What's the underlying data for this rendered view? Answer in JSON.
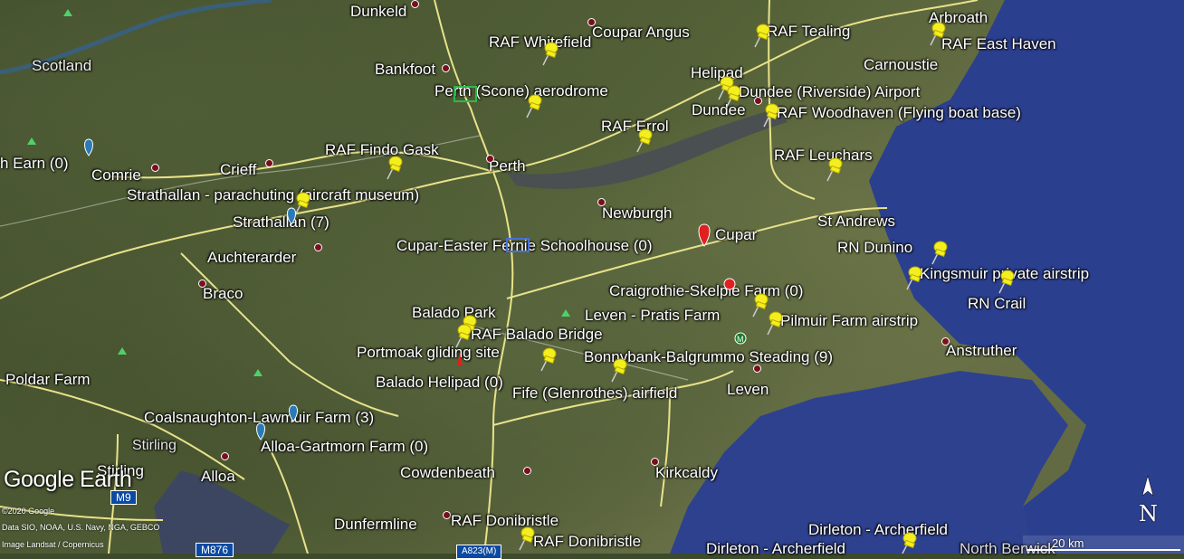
{
  "map": {
    "water_color": "#2b3f8f",
    "road_color": "#e8e28a",
    "pin_color": "#f3ef1f",
    "dot_color": "#7a0f1c"
  },
  "places": {
    "dunkeld": "Dunkeld",
    "coupar_angus": "Coupar Angus",
    "raf_tealing": "RAF Tealing",
    "arbroath": "Arbroath",
    "raf_east_haven": "RAF East Haven",
    "scotland": "Scotland",
    "raf_whitefield": "RAF Whitefield",
    "bankfoot": "Bankfoot",
    "carnoustie": "Carnoustie",
    "helipad": "Helipad",
    "perth_scone": "Perth (Scone) aerodrome",
    "dundee_riverside": "Dundee (Riverside) Airport",
    "dundee": "Dundee",
    "raf_woodhaven": "RAF Woodhaven (Flying boat base)",
    "raf_errol": "RAF Errol",
    "earn": "h Earn (0)",
    "raf_findo_gask": "RAF Findo Gask",
    "perth": "Perth",
    "raf_leuchars": "RAF Leuchars",
    "comrie": "Comrie",
    "crieff": "Crieff",
    "strathallan_para": "Strathallan - parachuting (aircraft museum)",
    "newburgh": "Newburgh",
    "strathallan": "Strathallan (7)",
    "st_andrews": "St Andrews",
    "cupar_easter": "Cupar-Easter Fernie Schoolhouse (0)",
    "cupar": "Cupar",
    "rn_dunino": "RN Dunino",
    "auchterarder": "Auchterarder",
    "kingsmuir": "Kingsmuir private airstrip",
    "rn_crail": "RN Crail",
    "braco": "Braco",
    "craigrothie": "Craigrothie-Skelpie Farm (0)",
    "balado_park": "Balado Park",
    "leven_pratis": "Leven - Pratis Farm",
    "pilmuir": "Pilmuir Farm airstrip",
    "raf_balado_bridge": "RAF Balado Bridge",
    "portmoak": "Portmoak gliding site",
    "bonnybank": "Bonnybank-Balgrummo Steading (9)",
    "anstruther": "Anstruther",
    "poldar": "Poldar Farm",
    "balado_helipad": "Balado Helipad (0)",
    "fife_glenrothes": "Fife (Glenrothes) airfield",
    "leven": "Leven",
    "coalsnaughton": "Coalsnaughton-Lawmuir Farm (3)",
    "stirling_small": "Stirling",
    "alloa_gartmorn": "Alloa-Gartmorn Farm (0)",
    "stirling": "Stirling",
    "alloa": "Alloa",
    "cowdenbeath": "Cowdenbeath",
    "kirkcaldy": "Kirkcaldy",
    "dunfermline": "Dunfermline",
    "raf_donibristle_1": "RAF Donibristle",
    "raf_donibristle_2": "RAF Donibristle",
    "dirleton_1": "Dirleton - Archerfield",
    "dirleton_2": "Dirleton - Archerfield",
    "north_berwick": "North Berwick"
  },
  "roads": {
    "m9": "M9",
    "m876": "M876",
    "a823m": "A823(M)"
  },
  "branding": {
    "logo": "Google Earth",
    "credit_1": "©2020 Google",
    "credit_2": "Data SIO, NOAA, U.S. Navy, NGA, GEBCO",
    "credit_3": "Image Landsat / Copernicus"
  },
  "scale": {
    "label": "20 km"
  },
  "compass": {
    "label": "N"
  }
}
